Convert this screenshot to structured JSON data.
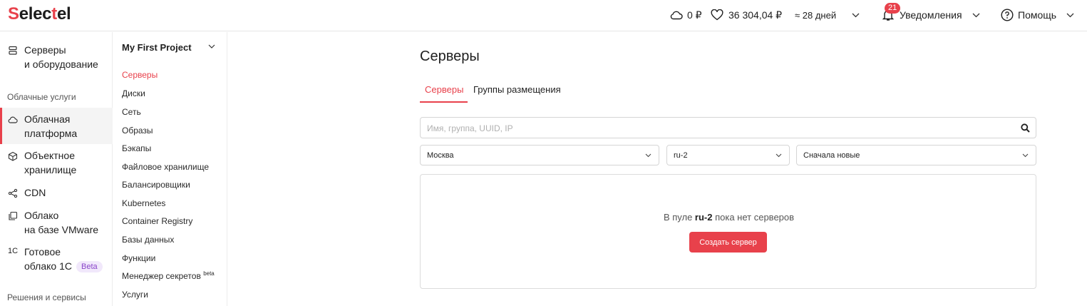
{
  "header": {
    "logo_prefix": "S",
    "logo_rest": "elec",
    "logo_red": "t",
    "logo_tail": "el",
    "cloud_balance": "0 ₽",
    "main_balance": "36 304,04 ₽",
    "days_left": "≈ 28 дней",
    "notifications_count": "21",
    "notifications_label": "Уведомления",
    "help_label": "Помощь"
  },
  "sidebar": {
    "items": [
      {
        "line1": "Серверы",
        "line2": "и оборудование",
        "icon": "server-icon"
      },
      {
        "line1": "Облачная",
        "line2": "платформа",
        "icon": "cloud-icon"
      },
      {
        "line1": "Объектное",
        "line2": "хранилище",
        "icon": "cube-icon"
      },
      {
        "line1": "CDN",
        "icon": "cdn-icon"
      },
      {
        "line1": "Облако",
        "line2": "на базе VMware",
        "icon": "vmware-icon"
      },
      {
        "line1": "Готовое",
        "line2": "облако 1С",
        "icon": "1c-icon",
        "badge": "Beta"
      }
    ],
    "groups": [
      "Облачные услуги",
      "Решения и сервисы"
    ],
    "icon_1c": "1С"
  },
  "project": {
    "title": "My First Project",
    "nav": [
      "Серверы",
      "Диски",
      "Сеть",
      "Образы",
      "Бэкапы",
      "Файловое хранилище",
      "Балансировщики",
      "Kubernetes",
      "Container Registry",
      "Базы данных",
      "Функции",
      "Менеджер секретов",
      "Услуги"
    ],
    "nav_beta_sup": "beta"
  },
  "main": {
    "title": "Серверы",
    "tabs": [
      "Серверы",
      "Группы размещения"
    ],
    "search_placeholder": "Имя, группа, UUID, IP",
    "filters": {
      "region": "Москва",
      "pool": "ru-2",
      "sort": "Сначала новые"
    },
    "empty_prefix": "В пуле ",
    "empty_pool": "ru-2",
    "empty_suffix": " пока нет серверов",
    "create_button": "Создать сервер"
  },
  "colors": {
    "accent": "#e8414b",
    "beta_bg": "#f1e8fb",
    "beta_text": "#8a45c9"
  }
}
